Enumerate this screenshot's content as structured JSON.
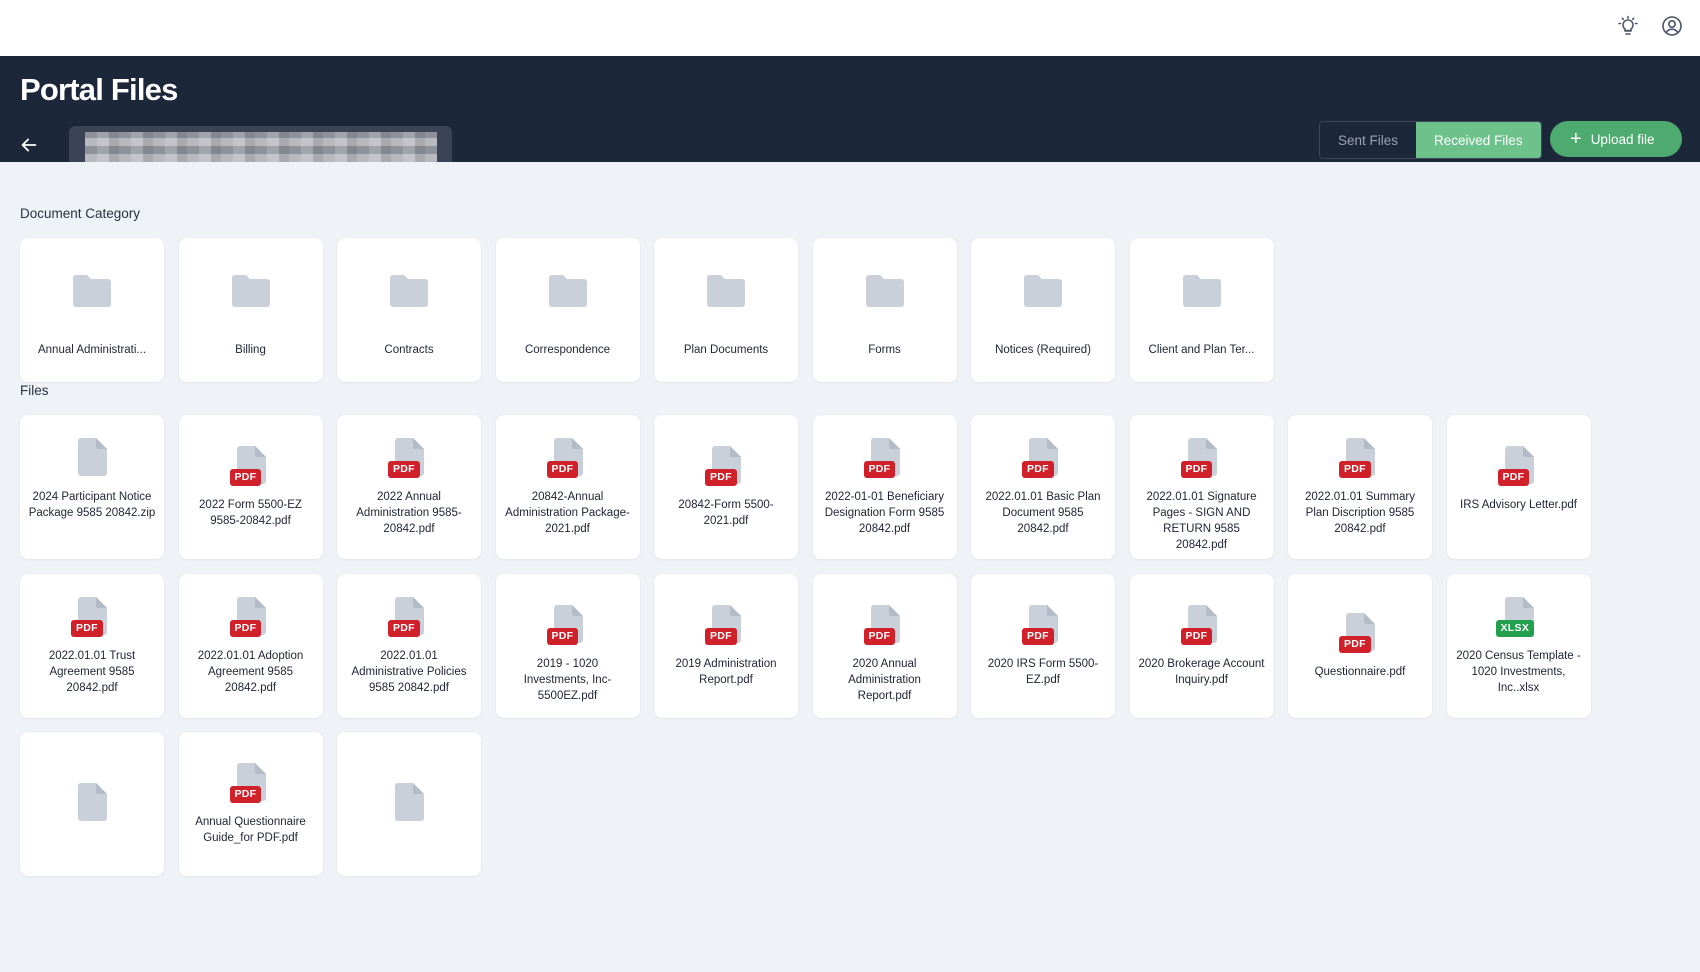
{
  "header": {
    "title": "Portal Files"
  },
  "toolbar": {
    "sent_label": "Sent Files",
    "received_label": "Received Files",
    "upload_label": "Upload file",
    "upload_icon": "+"
  },
  "sections": {
    "categories_label": "Document Category",
    "files_label": "Files"
  },
  "categories": [
    {
      "label": "Annual Administrati..."
    },
    {
      "label": "Billing"
    },
    {
      "label": "Contracts"
    },
    {
      "label": "Correspondence"
    },
    {
      "label": "Plan Documents"
    },
    {
      "label": "Forms"
    },
    {
      "label": "Notices (Required)"
    },
    {
      "label": "Client and Plan Ter..."
    }
  ],
  "files": [
    {
      "name": "2024 Participant Notice Package 9585 20842.zip",
      "type": ""
    },
    {
      "name": "2022 Form 5500-EZ 9585-20842.pdf",
      "type": "PDF"
    },
    {
      "name": "2022 Annual Administration 9585-20842.pdf",
      "type": "PDF"
    },
    {
      "name": "20842-Annual Administration Package-2021.pdf",
      "type": "PDF"
    },
    {
      "name": "20842-Form 5500-2021.pdf",
      "type": "PDF"
    },
    {
      "name": "2022-01-01 Beneficiary Designation Form 9585 20842.pdf",
      "type": "PDF"
    },
    {
      "name": "2022.01.01 Basic Plan Document 9585 20842.pdf",
      "type": "PDF"
    },
    {
      "name": "2022.01.01 Signature Pages - SIGN AND RETURN 9585 20842.pdf",
      "type": "PDF"
    },
    {
      "name": "2022.01.01 Summary Plan Discription 9585 20842.pdf",
      "type": "PDF"
    },
    {
      "name": "IRS Advisory Letter.pdf",
      "type": "PDF"
    },
    {
      "name": "2022.01.01 Trust Agreement 9585 20842.pdf",
      "type": "PDF"
    },
    {
      "name": "2022.01.01 Adoption Agreement 9585 20842.pdf",
      "type": "PDF"
    },
    {
      "name": "2022.01.01 Administrative Policies 9585 20842.pdf",
      "type": "PDF"
    },
    {
      "name": "2019 - 1020 Investments, Inc-5500EZ.pdf",
      "type": "PDF"
    },
    {
      "name": "2019 Administration Report.pdf",
      "type": "PDF"
    },
    {
      "name": "2020 Annual Administration Report.pdf",
      "type": "PDF"
    },
    {
      "name": "2020 IRS Form 5500-EZ.pdf",
      "type": "PDF"
    },
    {
      "name": "2020 Brokerage Account Inquiry.pdf",
      "type": "PDF"
    },
    {
      "name": "Questionnaire.pdf",
      "type": "PDF"
    },
    {
      "name": "2020 Census Template - 1020 Investments, Inc..xlsx",
      "type": "XLSX"
    },
    {
      "name": "",
      "type": ""
    },
    {
      "name": "Annual Questionnaire Guide_for PDF.pdf",
      "type": "PDF"
    },
    {
      "name": "",
      "type": ""
    }
  ],
  "colors": {
    "header_bg": "#1c273a",
    "accent_green": "#4eab6f",
    "toggle_active": "#6cc28a",
    "pdf_badge": "#d0202a",
    "xlsx_badge": "#22a04d"
  }
}
